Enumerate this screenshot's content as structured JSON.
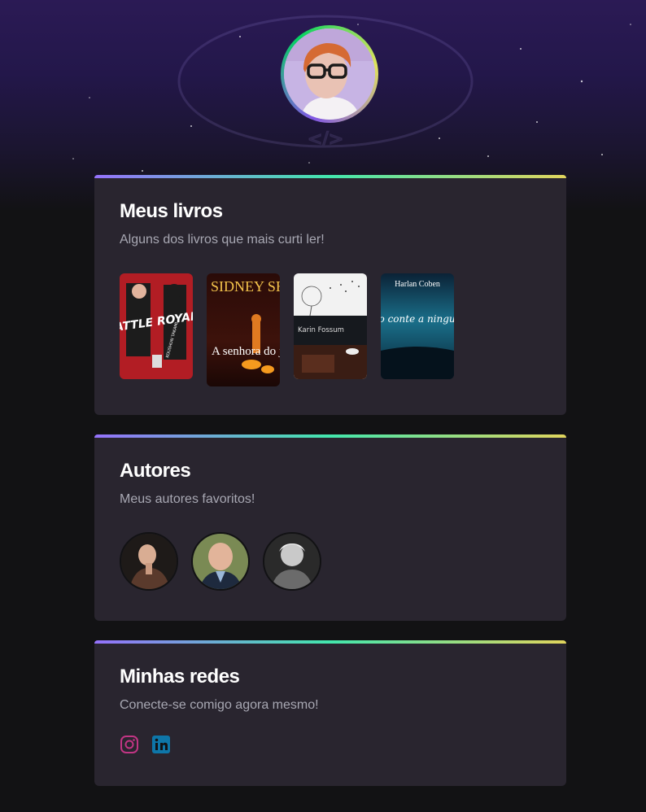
{
  "profile": {
    "avatar_icon": "profile-photo",
    "background_logo": "esports-nlw-logo"
  },
  "books_section": {
    "title": "Meus livros",
    "subtitle": "Alguns dos livros que mais curti ler!",
    "books": [
      {
        "title": "BATTLE ROYALE",
        "author": "KOUSHUN TAKAMI"
      },
      {
        "title": "A senhora do jogo",
        "author": "SIDNEY SHELDON"
      },
      {
        "title": "",
        "author": "Karin Fossum"
      },
      {
        "title": "Não conte a ninguém",
        "author": "Harlan Coben"
      }
    ]
  },
  "authors_section": {
    "title": "Autores",
    "subtitle": "Meus autores favoritos!",
    "authors": [
      {
        "icon": "author-photo-1"
      },
      {
        "icon": "author-photo-2"
      },
      {
        "icon": "author-photo-3"
      }
    ]
  },
  "social_section": {
    "title": "Minhas redes",
    "subtitle": "Conecte-se comigo agora mesmo!",
    "links": [
      {
        "icon": "instagram-icon",
        "color": "#c13584"
      },
      {
        "icon": "linkedin-icon",
        "color": "#0e76a8"
      }
    ]
  }
}
